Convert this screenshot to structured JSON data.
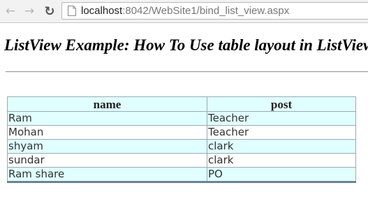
{
  "browser": {
    "url_host": "localhost",
    "url_rest": ":8042/WebSite1/bind_list_view.aspx",
    "back_icon": "arrow-left",
    "forward_icon": "arrow-right",
    "reload_icon": "reload"
  },
  "page": {
    "heading": "ListView Example: How To Use table layout in ListView"
  },
  "table": {
    "headers": [
      "name",
      "post"
    ],
    "rows": [
      [
        "Ram",
        "Teacher"
      ],
      [
        "Mohan",
        "Teacher"
      ],
      [
        "shyam",
        "clark"
      ],
      [
        "sundar",
        "clark"
      ],
      [
        "Ram share",
        "PO"
      ]
    ],
    "colors": {
      "alt_row": "#e0ffff",
      "border": "#9aaab4",
      "footer_line": "#6e8290"
    }
  }
}
